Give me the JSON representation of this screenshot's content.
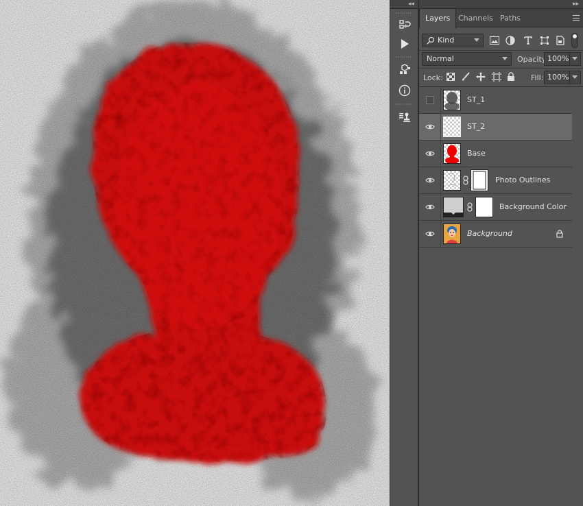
{
  "colors": {
    "canvas_bg": "#dcdcdc",
    "silhouette_red": "#c40808",
    "grunge_gray": "#5a5a5a",
    "panel_bg": "#535353",
    "selected_row": "#6a6a6a"
  },
  "toolstrip": {
    "collapse_glyph": "◂◂",
    "tools": [
      "history-icon",
      "play-action-icon",
      "3d-cube-icon",
      "info-icon",
      "stamp-icon"
    ]
  },
  "panel": {
    "collapse_glyph": "▸▸",
    "tabs": [
      {
        "label": "Layers",
        "active": true
      },
      {
        "label": "Channels",
        "active": false
      },
      {
        "label": "Paths",
        "active": false
      }
    ],
    "filter": {
      "kind_label": "Kind",
      "icons": [
        "image-filter-icon",
        "adjustment-filter-icon",
        "type-filter-icon",
        "shape-filter-icon",
        "smart-object-filter-icon",
        "filter-toggle-icon"
      ]
    },
    "blend_mode": "Normal",
    "opacity_label": "Opacity:",
    "opacity_value": "100%",
    "lock_label": "Lock:",
    "lock_icons": [
      "lock-transparent-icon",
      "lock-image-icon",
      "lock-position-icon",
      "lock-artboard-icon",
      "lock-all-icon"
    ],
    "fill_label": "Fill:",
    "fill_value": "100%"
  },
  "layers": [
    {
      "name": "ST_1",
      "visible": false,
      "selected": false,
      "thumb": "grunge",
      "mask": false,
      "italic": false,
      "locked": false
    },
    {
      "name": "ST_2",
      "visible": true,
      "selected": true,
      "thumb": "checker",
      "mask": false,
      "italic": false,
      "locked": false
    },
    {
      "name": "Base",
      "visible": true,
      "selected": false,
      "thumb": "red-silhouette",
      "mask": false,
      "italic": false,
      "locked": false
    },
    {
      "name": "Photo Outlines",
      "visible": true,
      "selected": false,
      "thumb": "white-sketch",
      "mask": true,
      "italic": false,
      "locked": false
    },
    {
      "name": "Background Color",
      "visible": true,
      "selected": false,
      "thumb": "gray-fill",
      "mask": true,
      "italic": false,
      "locked": false
    },
    {
      "name": "Background",
      "visible": true,
      "selected": false,
      "thumb": "photo",
      "mask": false,
      "italic": true,
      "locked": true
    }
  ]
}
